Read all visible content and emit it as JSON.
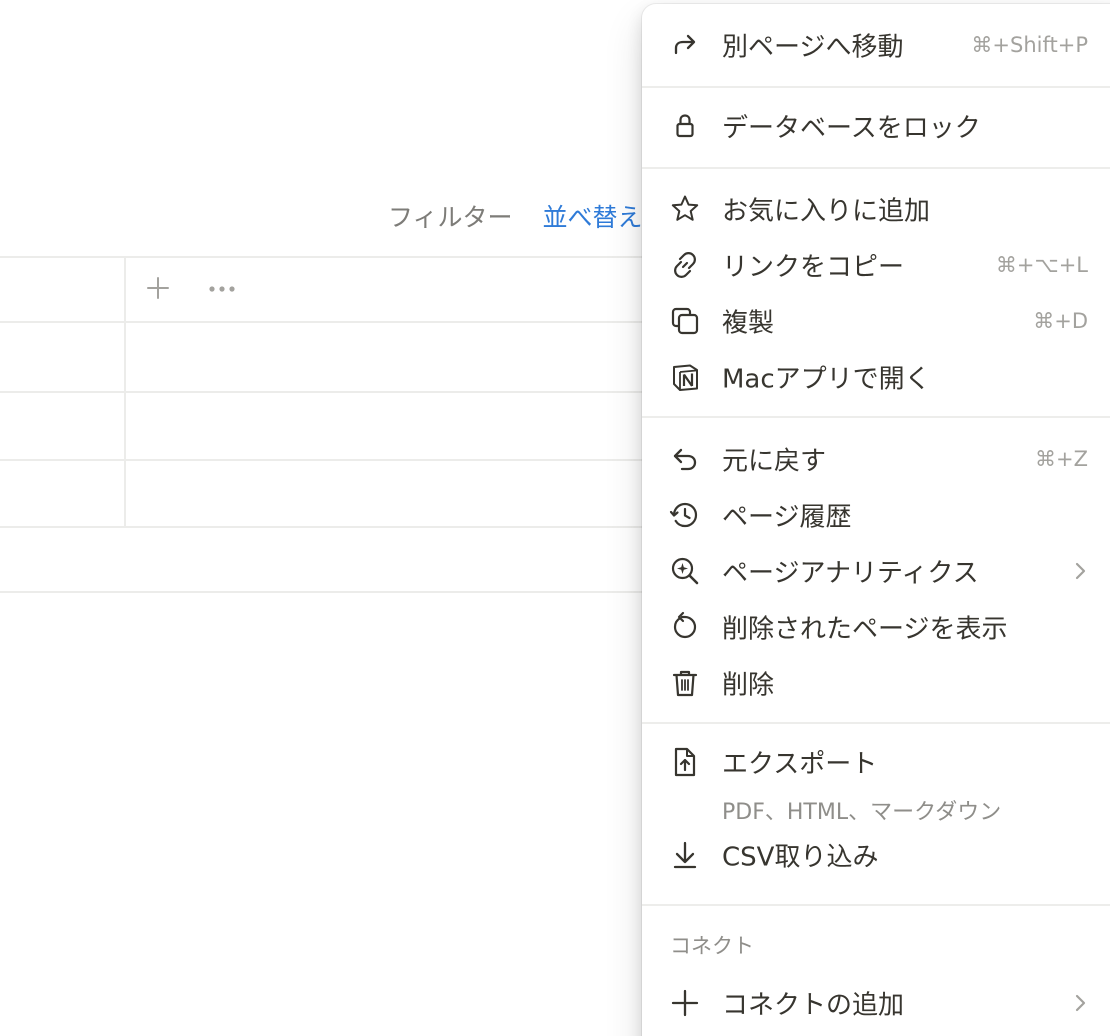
{
  "toolbar": {
    "filter_label": "フィルター",
    "sort_label": "並べ替え"
  },
  "table": {
    "add_property_icon": "plus-icon",
    "more_icon": "ellipsis-icon"
  },
  "menu": {
    "move_to": {
      "label": "別ページへ移動",
      "shortcut": "⌘+Shift+P",
      "icon": "arrow-turn-right-icon"
    },
    "lock_database": {
      "label": "データベースをロック",
      "icon": "lock-icon"
    },
    "add_favorite": {
      "label": "お気に入りに追加",
      "icon": "star-icon"
    },
    "copy_link": {
      "label": "リンクをコピー",
      "shortcut": "⌘+⌥+L",
      "icon": "link-icon"
    },
    "duplicate": {
      "label": "複製",
      "shortcut": "⌘+D",
      "icon": "duplicate-icon"
    },
    "open_mac_app": {
      "label": "Macアプリで開く",
      "icon": "notion-logo-icon"
    },
    "undo": {
      "label": "元に戻す",
      "shortcut": "⌘+Z",
      "icon": "undo-icon"
    },
    "page_history": {
      "label": "ページ履歴",
      "icon": "history-icon"
    },
    "page_analytics": {
      "label": "ページアナリティクス",
      "icon": "analytics-search-icon"
    },
    "show_deleted": {
      "label": "削除されたページを表示",
      "icon": "restore-icon"
    },
    "delete": {
      "label": "削除",
      "icon": "trash-icon"
    },
    "export": {
      "label": "エクスポート",
      "sublabel": "PDF、HTML、マークダウン",
      "icon": "export-file-icon"
    },
    "import_csv": {
      "label": "CSV取り込み",
      "icon": "download-arrow-icon"
    },
    "connections_header": "コネクト",
    "add_connection": {
      "label": "コネクトの追加",
      "icon": "plus-icon"
    }
  },
  "colors": {
    "accent_blue": "#2f7bd8",
    "text_primary": "#37352f",
    "text_muted": "#a3a29e",
    "divider": "#ededeb"
  }
}
